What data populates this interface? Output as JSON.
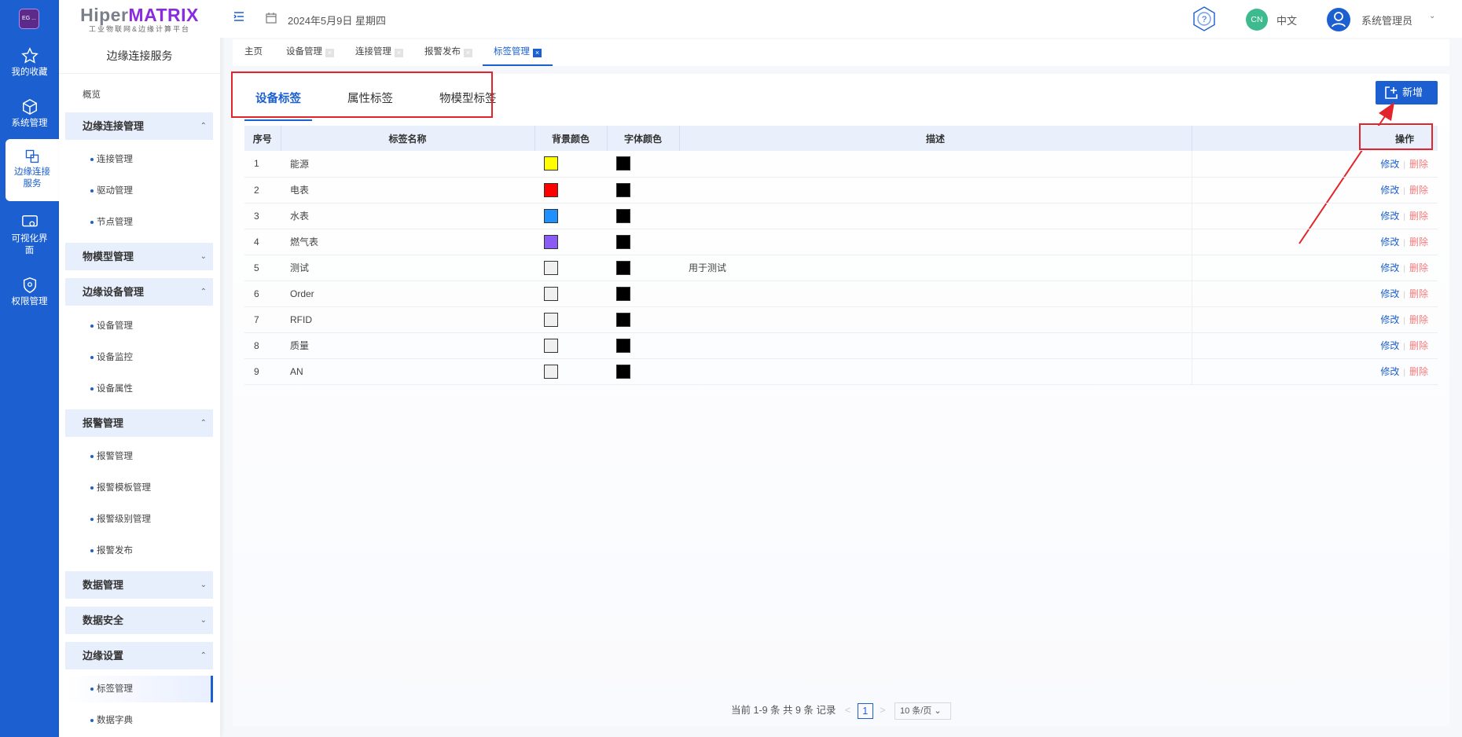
{
  "rail": {
    "logo": "EG ...",
    "items": [
      {
        "label": "我的收藏",
        "icon": "star-icon"
      },
      {
        "label": "系统管理",
        "icon": "cube-icon"
      },
      {
        "label": "边缘连接服务",
        "icon": "connect-icon"
      },
      {
        "label": "可视化界面",
        "icon": "monitor-eye-icon"
      },
      {
        "label": "权限管理",
        "icon": "shield-icon"
      }
    ]
  },
  "sidebar": {
    "brand_prefix": "Hiper",
    "brand_suffix": "MATRIX",
    "brand_sub": "工业物联网&边缘计算平台",
    "title": "边缘连接服务",
    "overview": "概览",
    "groups": [
      {
        "label": "边缘连接管理",
        "chevron": "⌃",
        "items": [
          "连接管理",
          "驱动管理",
          "节点管理"
        ]
      },
      {
        "label": "物模型管理",
        "chevron": "⌄",
        "items": []
      },
      {
        "label": "边缘设备管理",
        "chevron": "⌃",
        "items": [
          "设备管理",
          "设备监控",
          "设备属性"
        ]
      },
      {
        "label": "报警管理",
        "chevron": "⌃",
        "items": [
          "报警管理",
          "报警模板管理",
          "报警级别管理",
          "报警发布"
        ]
      },
      {
        "label": "数据管理",
        "chevron": "⌄",
        "items": []
      },
      {
        "label": "数据安全",
        "chevron": "⌄",
        "items": []
      },
      {
        "label": "边缘设置",
        "chevron": "⌃",
        "items": [
          "标签管理",
          "数据字典"
        ]
      }
    ]
  },
  "header": {
    "date": "2024年5月9日 星期四",
    "lang_badge": "CN",
    "lang": "中文",
    "user": "系统管理员",
    "user_chevron": "⌄"
  },
  "page_tabs": [
    {
      "label": "主页",
      "closable": false
    },
    {
      "label": "设备管理",
      "closable": true
    },
    {
      "label": "连接管理",
      "closable": true
    },
    {
      "label": "报警发布",
      "closable": true
    },
    {
      "label": "标签管理",
      "closable": true,
      "active": true
    }
  ],
  "content": {
    "tabs": [
      "设备标签",
      "属性标签",
      "物模型标签"
    ],
    "add_button": "新增",
    "columns": [
      "序号",
      "标签名称",
      "背景颜色",
      "字体颜色",
      "描述",
      "操作"
    ],
    "edit_label": "修改",
    "delete_label": "删除",
    "sep": "|",
    "rows": [
      {
        "no": "1",
        "name": "能源",
        "bg": "#ffff00",
        "fg": "#000000",
        "desc": ""
      },
      {
        "no": "2",
        "name": "电表",
        "bg": "#ff0000",
        "fg": "#000000",
        "desc": ""
      },
      {
        "no": "3",
        "name": "水表",
        "bg": "#1e90ff",
        "fg": "#000000",
        "desc": ""
      },
      {
        "no": "4",
        "name": "燃气表",
        "bg": "#8a5cf5",
        "fg": "#000000",
        "desc": ""
      },
      {
        "no": "5",
        "name": "测试",
        "bg": "#f0f0f0",
        "fg": "#000000",
        "desc": "用于测试"
      },
      {
        "no": "6",
        "name": "Order",
        "bg": "#f0f0f0",
        "fg": "#000000",
        "desc": ""
      },
      {
        "no": "7",
        "name": "RFID",
        "bg": "#f0f0f0",
        "fg": "#000000",
        "desc": ""
      },
      {
        "no": "8",
        "name": "质量",
        "bg": "#f0f0f0",
        "fg": "#000000",
        "desc": ""
      },
      {
        "no": "9",
        "name": "AN",
        "bg": "#f0f0f0",
        "fg": "#000000",
        "desc": ""
      }
    ],
    "pager": {
      "summary": "当前 1-9 条 共 9 条 记录",
      "prev": "<",
      "page": "1",
      "next": ">",
      "page_size": "10 条/页 ⌄"
    }
  },
  "colors": {
    "primary": "#1b5fd0",
    "annotation": "#e3242b",
    "delete": "#f07b7b"
  }
}
